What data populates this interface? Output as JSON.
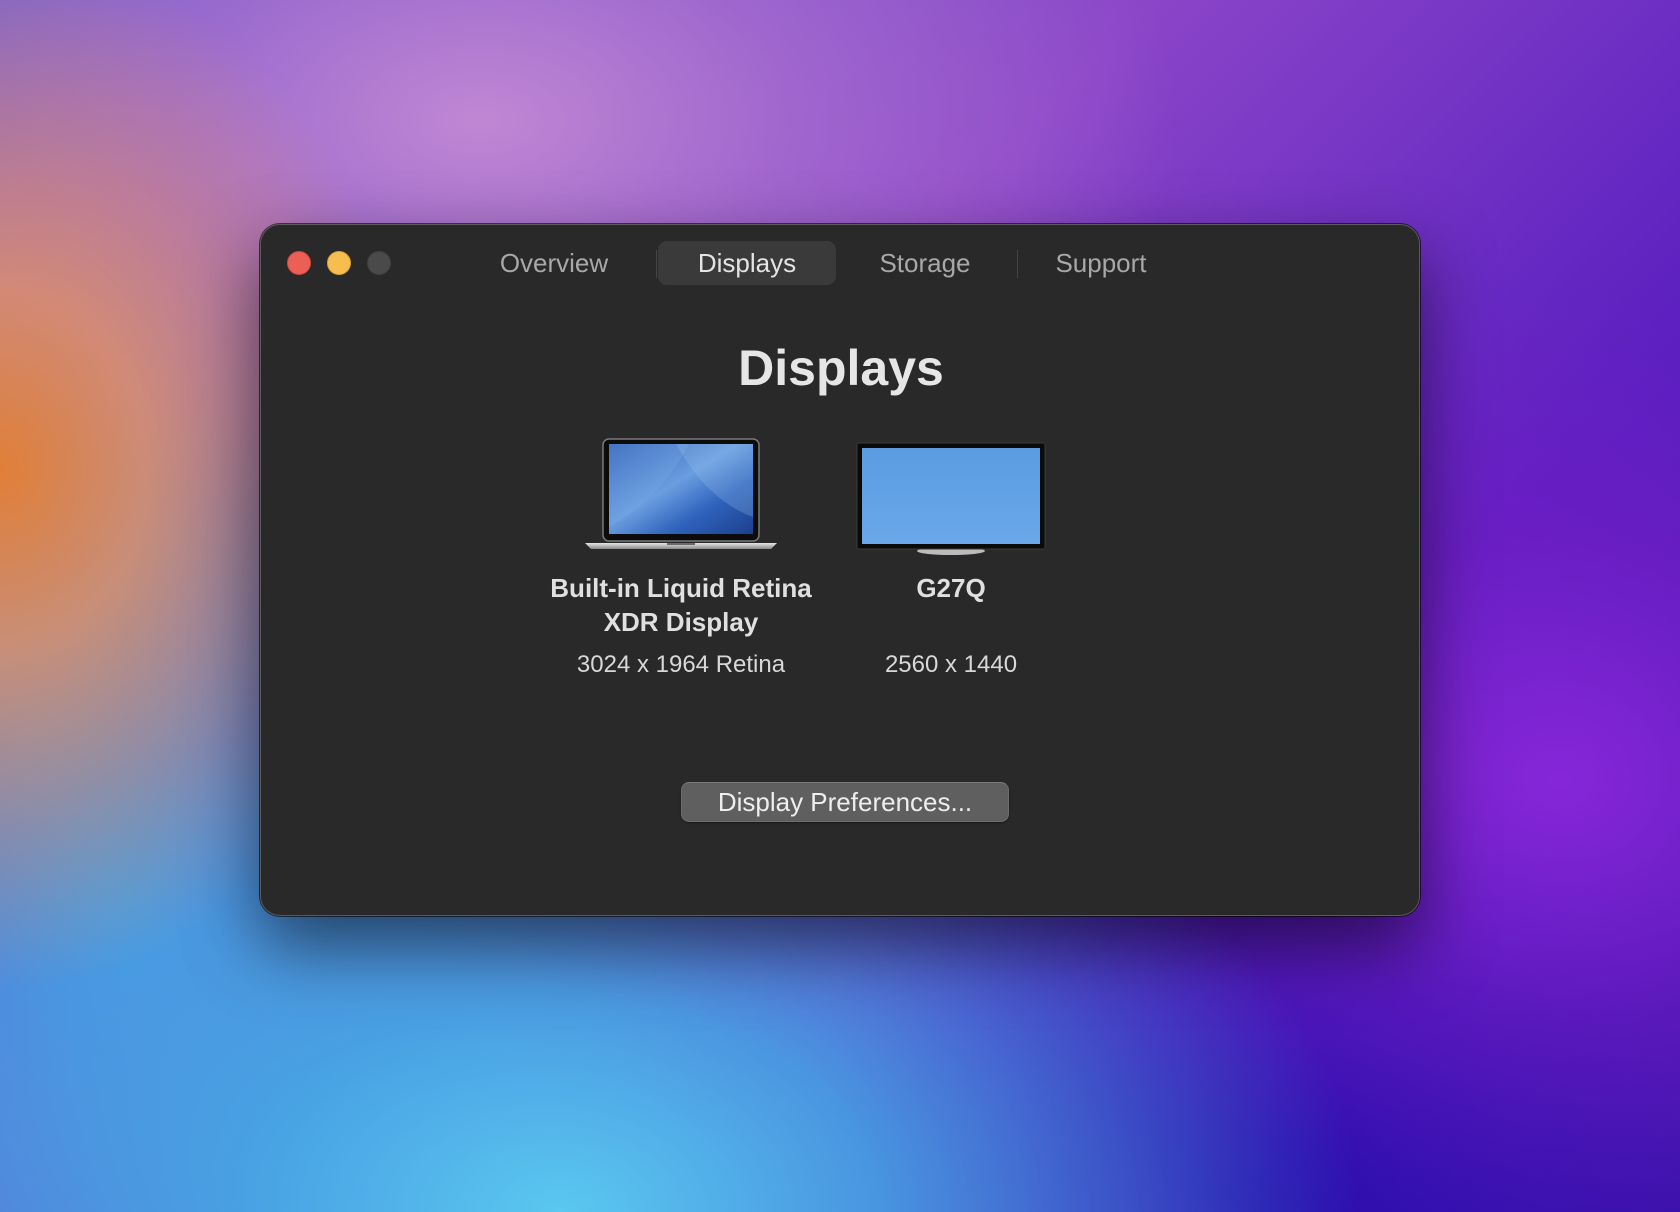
{
  "window": {
    "tabs": [
      {
        "label": "Overview",
        "active": false
      },
      {
        "label": "Displays",
        "active": true
      },
      {
        "label": "Storage",
        "active": false
      },
      {
        "label": "Support",
        "active": false
      }
    ],
    "title": "Displays"
  },
  "displays": [
    {
      "name_line1": "Built-in Liquid Retina",
      "name_line2": "XDR Display",
      "resolution": "3024 x 1964 Retina",
      "icon": "laptop-icon"
    },
    {
      "name_line1": "G27Q",
      "resolution": "2560 x 1440",
      "icon": "monitor-icon"
    }
  ],
  "buttons": {
    "display_preferences": "Display Preferences..."
  },
  "colors": {
    "window_bg": "#292929",
    "close": "#ec5f57",
    "minimize": "#f5be4f",
    "zoom_disabled": "#4a4a4a",
    "active_tab_bg": "#3a3a3a",
    "button_bg": "#5f5f5f",
    "screen_blue": "#5b9be0"
  }
}
